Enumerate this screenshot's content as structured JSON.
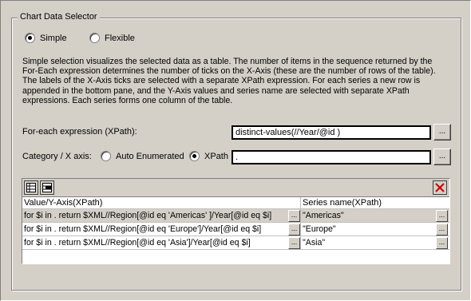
{
  "group": {
    "title": "Chart Data Selector"
  },
  "mode": {
    "simple_label": "Simple",
    "flexible_label": "Flexible",
    "selected": "simple"
  },
  "description": "Simple selection visualizes the selected data as a table. The number of items in the sequence returned by the For-Each expression determines the number of ticks on the X-Axis (these are the number of rows of the table). The labels of the X-Axis ticks are selected with a separate XPath expression. For each series a new row is appended in the bottom pane, and the Y-Axis values and series name are selected with separate XPath expressions. Each series forms one column of the table.",
  "foreach": {
    "label": "For-each expression (XPath):",
    "value": "distinct-values(//Year/@id )",
    "browse_label": "..."
  },
  "category": {
    "label": "Category / X axis:",
    "auto_label": "Auto Enumerated",
    "xpath_label": "XPath",
    "selected": "xpath",
    "value": ".",
    "browse_label": "..."
  },
  "series_table": {
    "columns": [
      "Value/Y-Axis(XPath)",
      "Series name(XPath)"
    ],
    "rows": [
      {
        "value": "for $i in . return $XML//Region[@id eq 'Americas' ]/Year[@id eq $i]",
        "name": "\"Americas\""
      },
      {
        "value": "for $i in . return $XML//Region[@id eq 'Europe']/Year[@id eq $i]",
        "name": "\"Europe\""
      },
      {
        "value": "for $i in . return $XML//Region[@id eq 'Asia']/Year[@id eq $i]",
        "name": "\"Asia\""
      }
    ],
    "cell_button_label": "...",
    "toolbar_icons": [
      "append-row-icon",
      "insert-row-icon",
      "delete-row-icon"
    ],
    "delete_color": "#cc0000"
  }
}
